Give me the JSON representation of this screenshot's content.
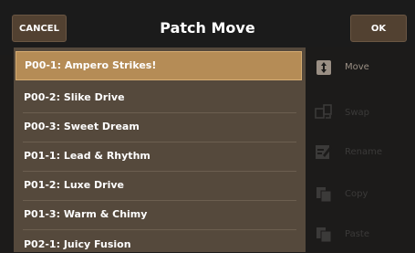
{
  "header": {
    "cancel_label": "CANCEL",
    "title": "Patch Move",
    "ok_label": "OK"
  },
  "patches": [
    {
      "label": "P00-1: Ampero Strikes!"
    },
    {
      "label": "P00-2: Slike Drive"
    },
    {
      "label": "P00-3: Sweet Dream"
    },
    {
      "label": "P01-1: Lead & Rhythm"
    },
    {
      "label": "P01-2: Luxe Drive"
    },
    {
      "label": "P01-3: Warm & Chimy"
    },
    {
      "label": "P02-1: Juicy Fusion"
    }
  ],
  "selected_index": 0,
  "actions": [
    {
      "label": "Move",
      "icon": "move-icon",
      "enabled": true
    },
    {
      "label": "Swap",
      "icon": "swap-icon",
      "enabled": false
    },
    {
      "label": "Rename",
      "icon": "rename-icon",
      "enabled": false
    },
    {
      "label": "Copy",
      "icon": "copy-icon",
      "enabled": false
    },
    {
      "label": "Paste",
      "icon": "paste-icon",
      "enabled": false
    }
  ],
  "colors": {
    "selected_row": "#b58c56",
    "list_background": "#55493c",
    "button_background": "#524131"
  }
}
